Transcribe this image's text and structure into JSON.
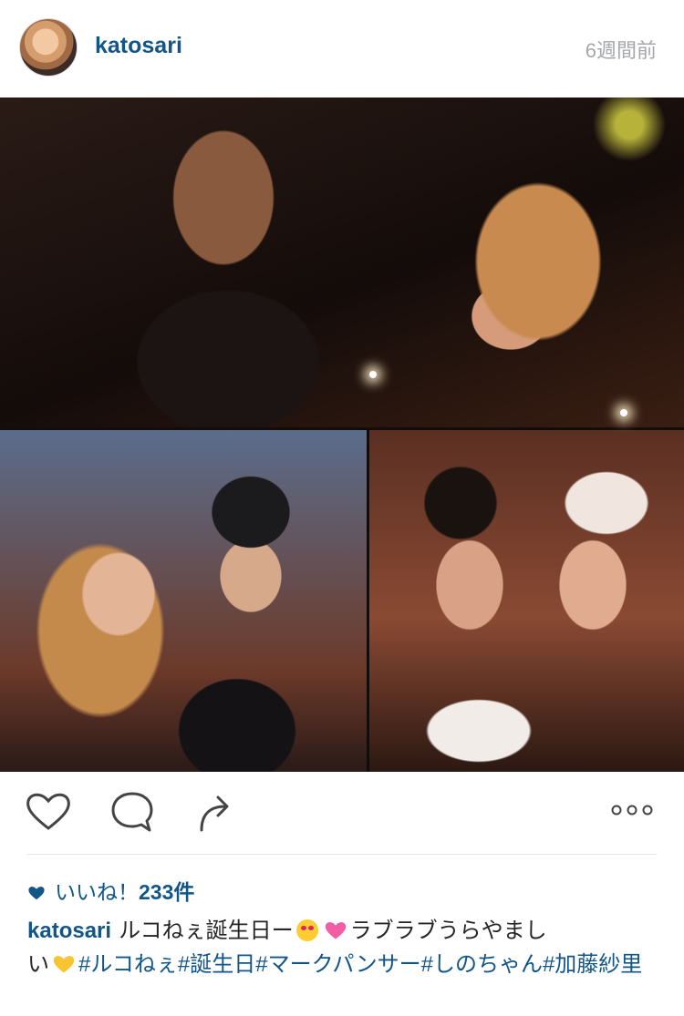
{
  "post": {
    "username": "katosari",
    "time_ago": "6週間前"
  },
  "photo": {
    "panels": [
      "top-party-photo",
      "bottom-left-selfie",
      "bottom-right-selfie"
    ]
  },
  "icons": {
    "like": "heart-outline-icon",
    "comment": "comment-bubble-icon",
    "share": "share-arrow-icon",
    "more": "more-dots-icon"
  },
  "likes": {
    "label": "いいね！",
    "count": "233件"
  },
  "caption": {
    "username": "katosari",
    "text_part1": "ルコねぇ誕生日ー",
    "text_part2": "ラブラブうらやまし",
    "text_part3": "い",
    "hashtags": [
      "#ルコねぇ",
      "#誕生日",
      "#マークパンサー",
      "#しのちゃん",
      "#加藤紗里"
    ]
  },
  "colors": {
    "link": "#125688",
    "meta": "#a5a7aa",
    "text": "#262626"
  }
}
